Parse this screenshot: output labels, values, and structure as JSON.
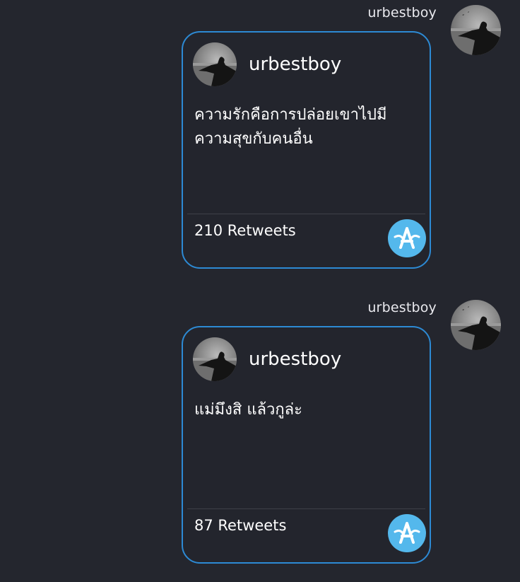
{
  "messages": [
    {
      "sender": "urbestboy",
      "card": {
        "username": "urbestboy",
        "text": "ความรักคือการปล่อยเขาไปมีความสุขกับคนอื่น",
        "retweets": "210 Retweets"
      }
    },
    {
      "sender": "urbestboy",
      "card": {
        "username": "urbestboy",
        "text": "แม่มึงสิ แล้วกูล่ะ",
        "retweets": "87 Retweets"
      }
    }
  ],
  "colors": {
    "background": "#24262e",
    "card_border": "#2d8ad4",
    "badge": "#54b8ec"
  },
  "icons": {
    "avatar": "profile-photo",
    "badge": "app-logo-icon"
  }
}
